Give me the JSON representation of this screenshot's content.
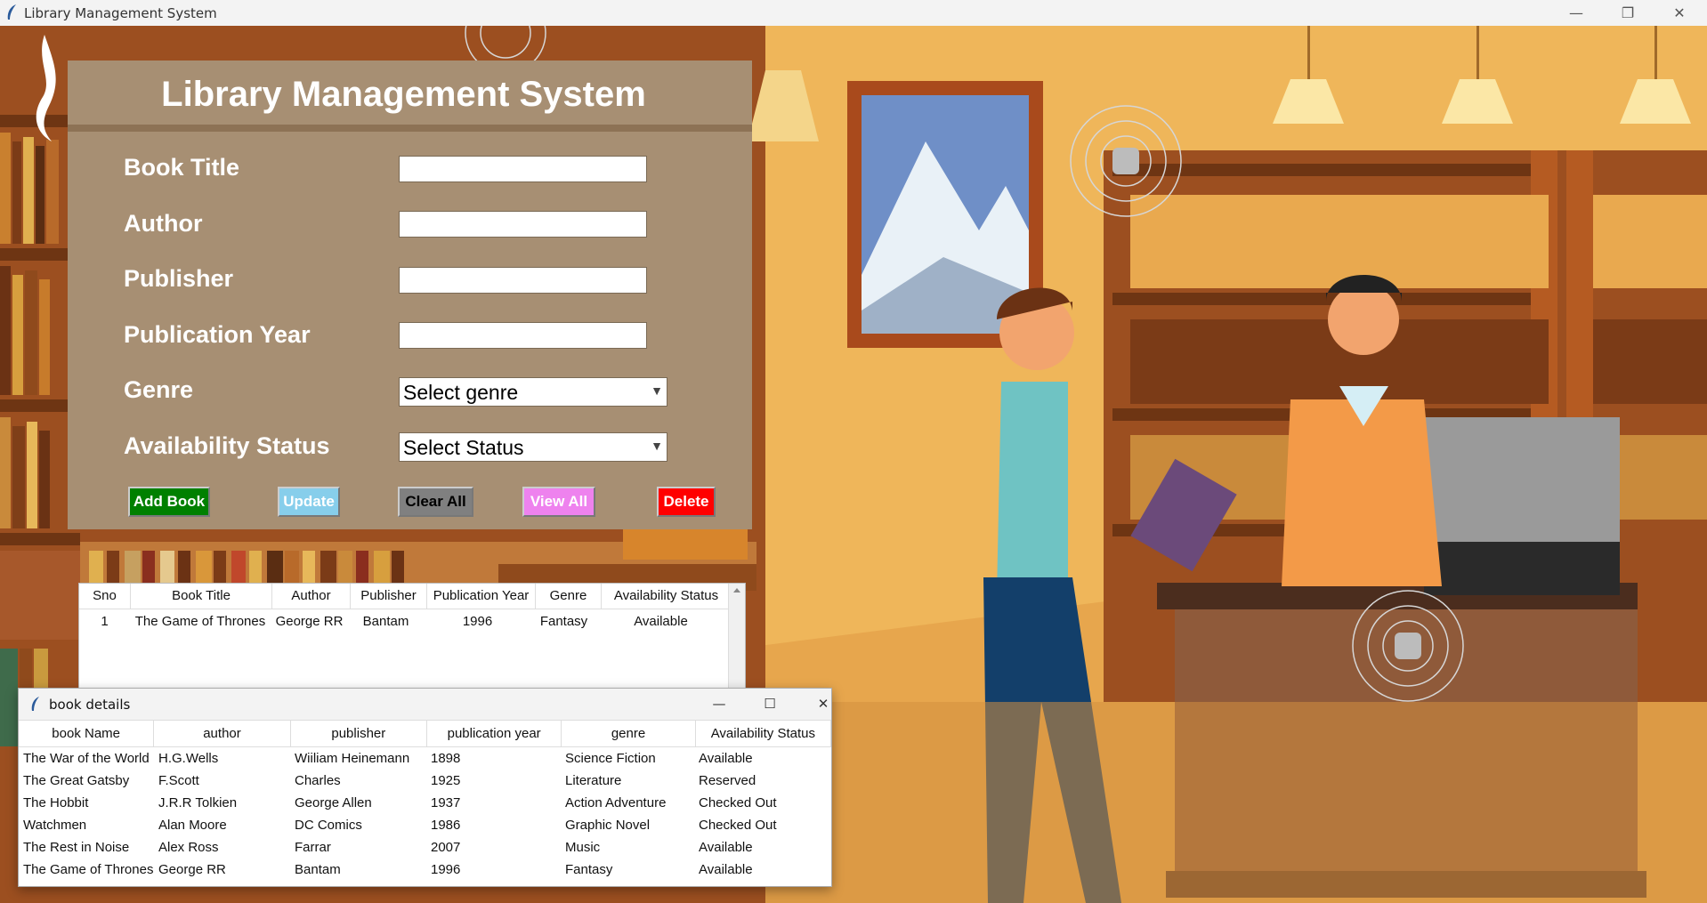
{
  "window": {
    "title": "Library Management System",
    "minimize": "—",
    "maximize": "❐",
    "close": "✕"
  },
  "header": {
    "title": "Library Management System"
  },
  "form": {
    "book_title_label": "Book Title",
    "author_label": "Author",
    "publisher_label": "Publisher",
    "publication_year_label": "Publication Year",
    "genre_label": "Genre",
    "genre_value": "Select genre",
    "status_label": "Availability Status",
    "status_value": "Select Status"
  },
  "buttons": {
    "add": {
      "label": "Add Book",
      "color": "#008000"
    },
    "update": {
      "label": "Update",
      "color": "#87ceeb"
    },
    "clear": {
      "label": "Clear All",
      "color": "#808080"
    },
    "view": {
      "label": "View All",
      "color": "#ee82ee"
    },
    "delete": {
      "label": "Delete",
      "color": "#ff0000"
    }
  },
  "main_table": {
    "columns": [
      "Sno",
      "Book Title",
      "Author",
      "Publisher",
      "Publication Year",
      "Genre",
      "Availability Status"
    ],
    "rows": [
      [
        "1",
        "The Game of Thrones",
        "George RR",
        "Bantam",
        "1996",
        "Fantasy",
        "Available"
      ]
    ]
  },
  "details_window": {
    "title": "book details",
    "minimize": "—",
    "maximize": "☐",
    "close": "✕",
    "columns": [
      "book Name",
      "author",
      "publisher",
      "publication year",
      "genre",
      "Availability Status"
    ],
    "rows": [
      [
        "The War of the World",
        "H.G.Wells",
        "Wiiliam Heinemann",
        "1898",
        "Science Fiction",
        "Available"
      ],
      [
        "The Great Gatsby",
        "F.Scott",
        "Charles",
        "1925",
        "Literature",
        "Reserved"
      ],
      [
        "The Hobbit",
        "J.R.R Tolkien",
        "George Allen",
        "1937",
        "Action Adventure",
        "Checked Out"
      ],
      [
        "Watchmen",
        "Alan Moore",
        "DC Comics",
        "1986",
        "Graphic Novel",
        "Checked Out"
      ],
      [
        "The Rest in Noise",
        "Alex Ross",
        "Farrar",
        "2007",
        "Music",
        "Available"
      ],
      [
        "The Game of Thrones",
        "George RR",
        "Bantam",
        "1996",
        "Fantasy",
        "Available"
      ]
    ]
  }
}
